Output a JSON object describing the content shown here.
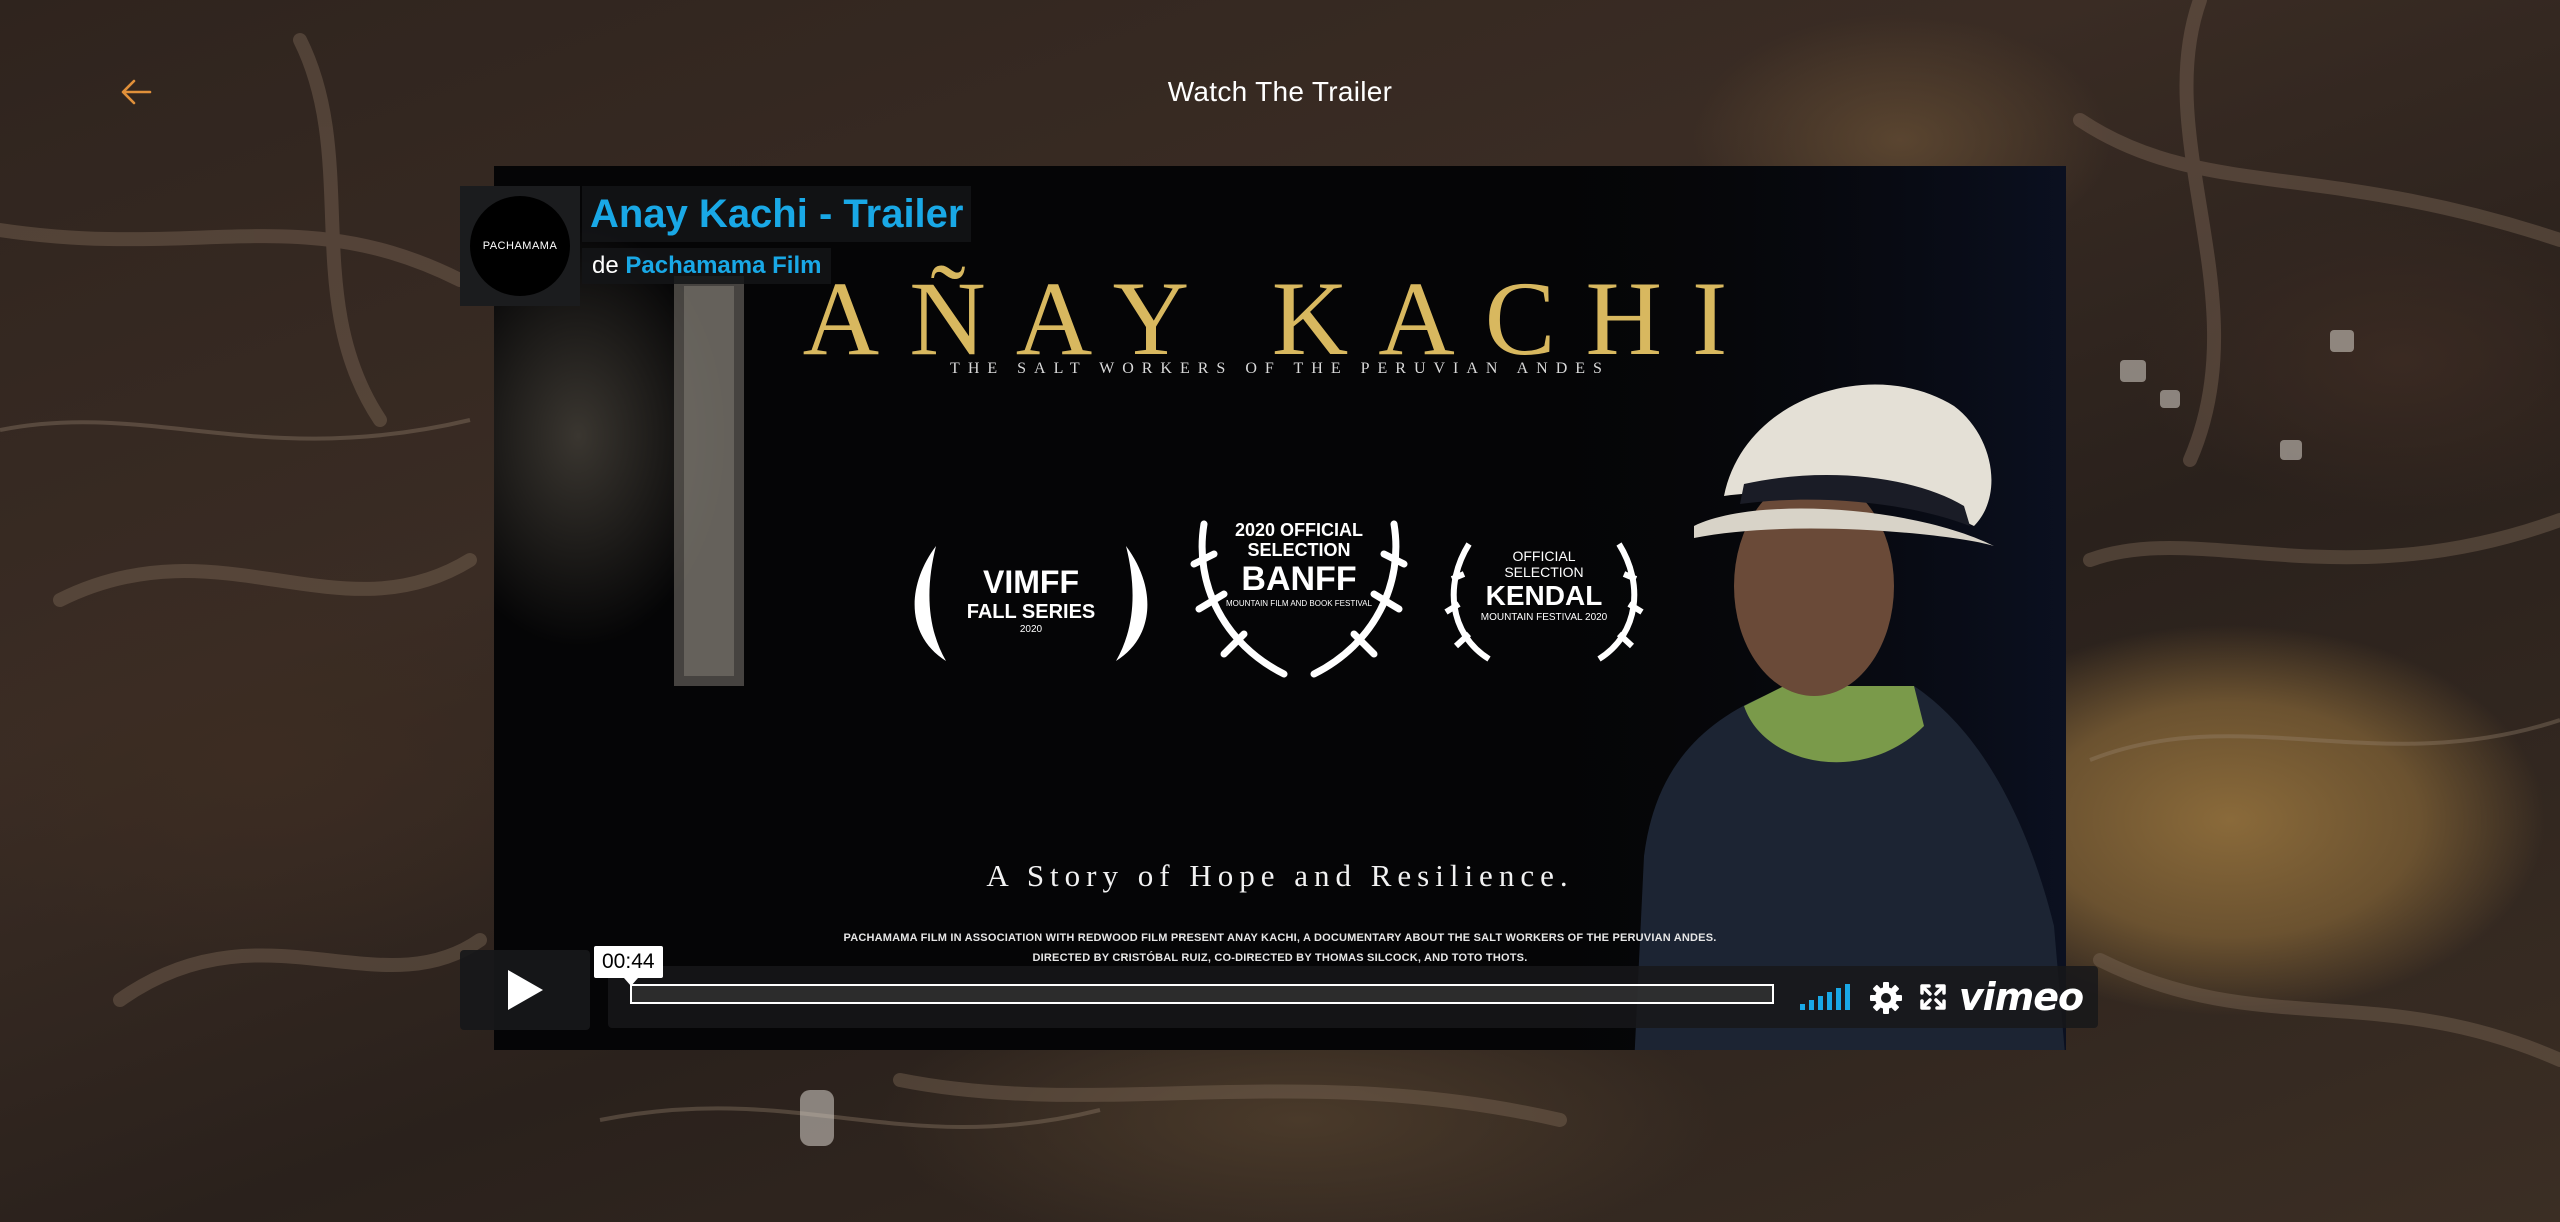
{
  "page": {
    "title": "Watch The Trailer"
  },
  "video": {
    "title": "Anay Kachi - Trailer",
    "byline_prefix": "de",
    "owner": "Pachamama Film",
    "avatar_text": "PACHAMAMA",
    "current_time": "00:44",
    "progress": 0.0,
    "brand": "vimeo"
  },
  "poster": {
    "title": "AÑAY KACHI",
    "subtitle": "THE SALT WORKERS OF THE PERUVIAN ANDES",
    "laurels": [
      {
        "line1": "VIMFF",
        "line2": "FALL SERIES",
        "line3": "2020"
      },
      {
        "line1": "2020 OFFICIAL SELECTION",
        "line2": "BANFF",
        "line3": "MOUNTAIN FILM AND BOOK FESTIVAL"
      },
      {
        "line1": "OFFICIAL SELECTION",
        "line2": "KENDAL",
        "line3": "MOUNTAIN FESTIVAL 2020"
      }
    ],
    "tagline": "A Story of Hope and Resilience.",
    "credits_1": "PACHAMAMA FILM IN ASSOCIATION WITH REDWOOD FILM PRESENT ANAY KACHI, A DOCUMENTARY ABOUT THE SALT WORKERS OF THE PERUVIAN ANDES.",
    "credits_2": "DIRECTED BY CRISTÓBAL RUIZ, CO-DIRECTED BY THOMAS SILCOCK, AND TOTO THOTS."
  },
  "colors": {
    "accent": "#19a8e6",
    "back_arrow": "#e0903a",
    "poster_gold": "#d8b85f"
  },
  "icons": [
    "back-arrow-icon",
    "play-icon",
    "volume-icon",
    "settings-icon",
    "fullscreen-icon",
    "vimeo-logo"
  ]
}
